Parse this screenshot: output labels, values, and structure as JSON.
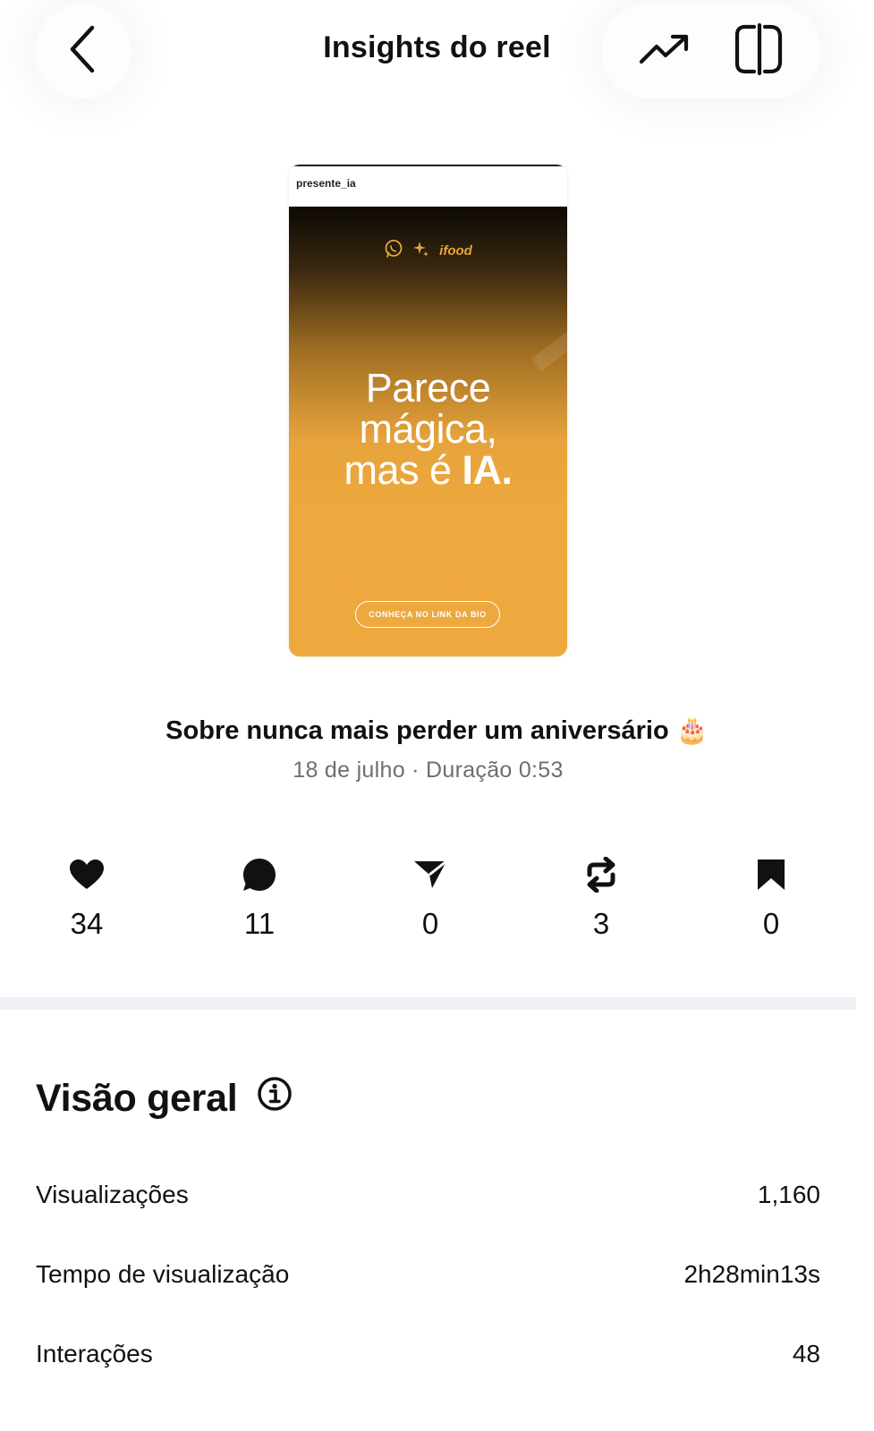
{
  "header": {
    "title": "Insights do reel",
    "back_icon": "chevron-left-icon",
    "trend_icon": "trending-up-icon",
    "compare_icon": "compare-panel-icon"
  },
  "thumbnail": {
    "handle": "presente_ia",
    "logo_text": "ifood",
    "headline_line1": "Parece",
    "headline_line2": "mágica,",
    "headline_line3a": "mas é ",
    "headline_line3b": "IA.",
    "cta": "CONHEÇA NO LINK DA BIO",
    "colors": {
      "dark": "#0d0905",
      "orange": "#eda83e"
    }
  },
  "reel": {
    "caption": "Sobre nunca mais perder um aniversário",
    "caption_emoji": "🎂",
    "meta": "18 de julho · Duração 0:53"
  },
  "stats": {
    "likes": "34",
    "comments": "11",
    "shares": "0",
    "reposts": "3",
    "saves": "0"
  },
  "overview": {
    "title": "Visão geral",
    "rows": [
      {
        "label": "Visualizações",
        "value": "1,160"
      },
      {
        "label": "Tempo de visualização",
        "value": "2h28min13s"
      },
      {
        "label": "Interações",
        "value": "48"
      }
    ]
  }
}
